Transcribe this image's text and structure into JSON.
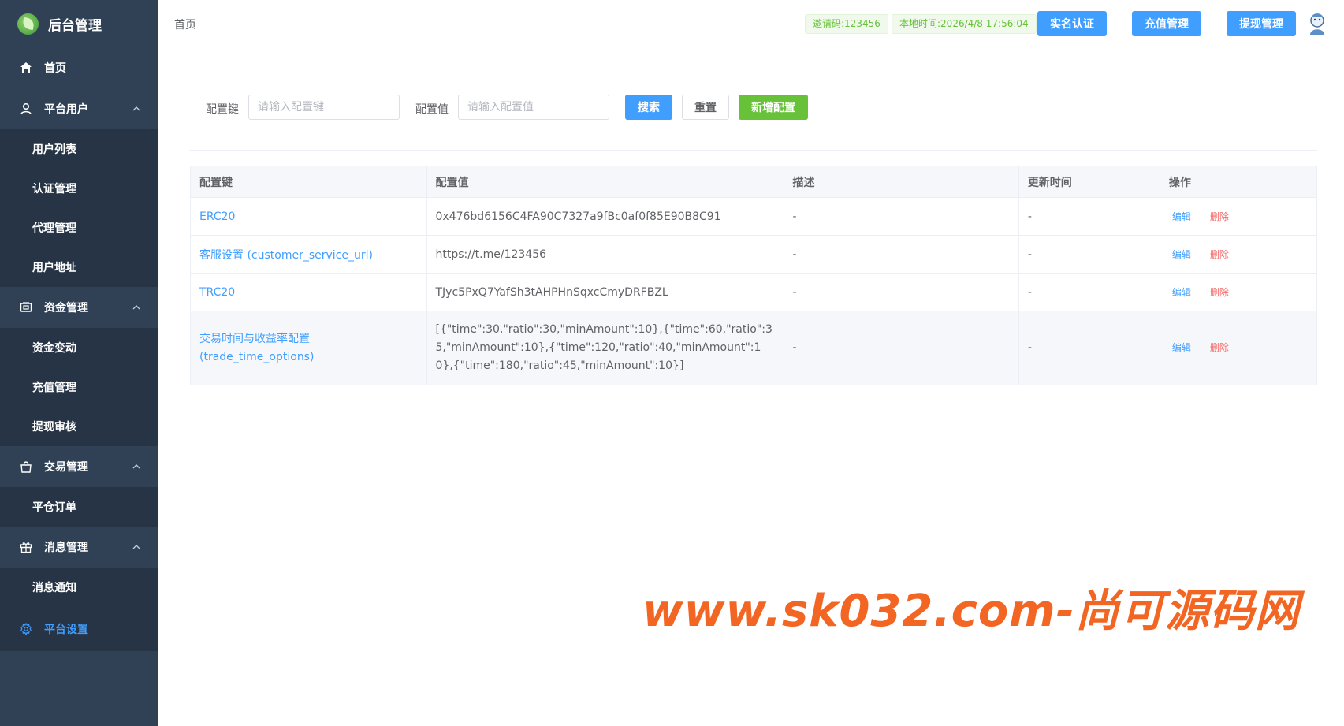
{
  "app": {
    "title": "后台管理"
  },
  "sidebar": {
    "home": "首页",
    "groups": [
      {
        "label": "平台用户",
        "items": [
          "用户列表",
          "认证管理",
          "代理管理",
          "用户地址"
        ]
      },
      {
        "label": "资金管理",
        "items": [
          "资金变动",
          "充值管理",
          "提现审核"
        ]
      },
      {
        "label": "交易管理",
        "items": [
          "平仓订单"
        ]
      },
      {
        "label": "消息管理",
        "items": [
          "消息通知"
        ]
      }
    ],
    "active": "平台设置"
  },
  "header": {
    "breadcrumb": "首页",
    "invite": "邀请码:123456",
    "time": "本地时间:2026/4/8 17:56:04",
    "buttons": [
      "实名认证",
      "充值管理",
      "提现管理"
    ]
  },
  "search": {
    "key_label": "配置键",
    "key_placeholder": "请输入配置键",
    "value_label": "配置值",
    "value_placeholder": "请输入配置值",
    "search_btn": "搜索",
    "reset_btn": "重置",
    "add_btn": "新增配置"
  },
  "table": {
    "headers": [
      "配置键",
      "配置值",
      "描述",
      "更新时间",
      "操作"
    ],
    "edit_label": "编辑",
    "delete_label": "删除",
    "rows": [
      {
        "key": "ERC20",
        "value": "0x476bd6156C4FA90C7327a9fBc0af0f85E90B8C91",
        "desc": "-",
        "updated": "-"
      },
      {
        "key": "客服设置 (customer_service_url)",
        "value": "https://t.me/123456",
        "desc": "-",
        "updated": "-"
      },
      {
        "key": "TRC20",
        "value": "TJyc5PxQ7YafSh3tAHPHnSqxcCmyDRFBZL",
        "desc": "-",
        "updated": "-"
      },
      {
        "key": "交易时间与收益率配置(trade_time_options)",
        "value": "[{\"time\":30,\"ratio\":30,\"minAmount\":10},{\"time\":60,\"ratio\":35,\"minAmount\":10},{\"time\":120,\"ratio\":40,\"minAmount\":10},{\"time\":180,\"ratio\":45,\"minAmount\":10}]",
        "desc": "-",
        "updated": "-"
      }
    ]
  },
  "watermark": "www.sk032.com-尚可源码网"
}
